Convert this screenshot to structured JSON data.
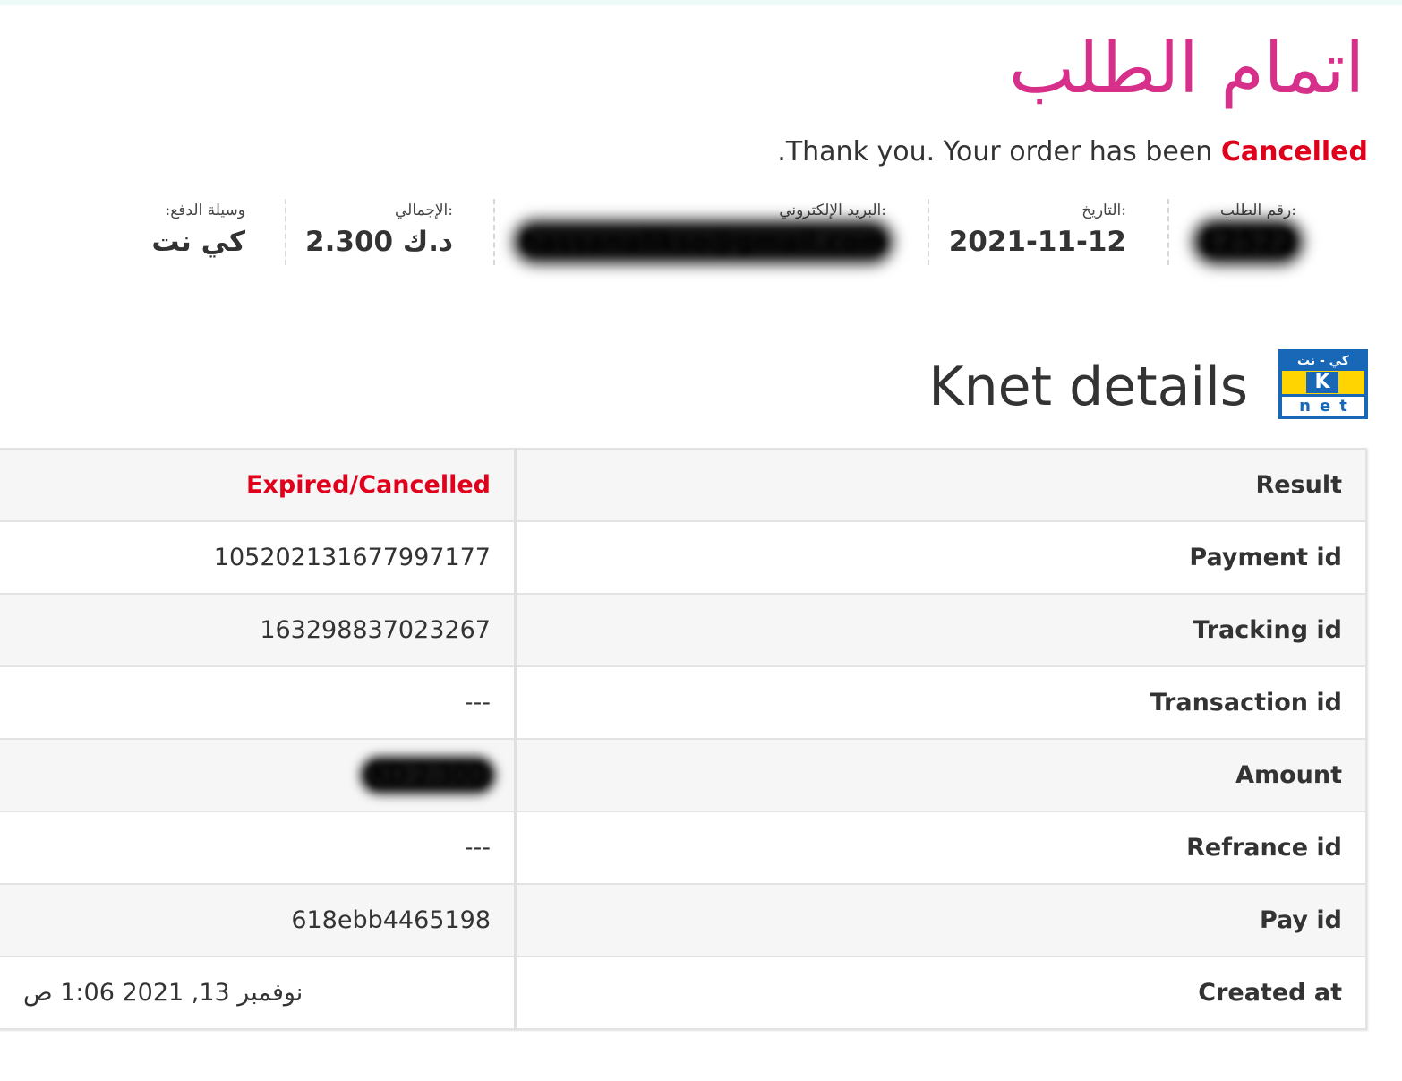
{
  "page": {
    "title": "اتمام الطلب",
    "thank_you_prefix": ".Thank you. Your order has been ",
    "order_status": "Cancelled"
  },
  "overview": {
    "order_number": {
      "label": "رقم الطلب:",
      "value": "12522"
    },
    "date": {
      "label": "التاريخ:",
      "value": "2021-11-12"
    },
    "email": {
      "label": "البريد الإلكتروني:",
      "value": "hassanalikso@gmail.com"
    },
    "total": {
      "label": "الإجمالي:",
      "value": "2.300 د.ك"
    },
    "payment_method": {
      "label": "وسيلة الدفع:",
      "value": "كي نت"
    }
  },
  "knet": {
    "heading": "Knet details",
    "logo_top_text": "كي - نت",
    "logo_letter": "K",
    "logo_bottom_text": "net",
    "brand_blue": "#1868b7",
    "brand_yellow": "#ffd400"
  },
  "details": {
    "rows": [
      {
        "key": "Result",
        "value": "Expired/Cancelled"
      },
      {
        "key": "Payment id",
        "value": "105202131677997177"
      },
      {
        "key": "Tracking id",
        "value": "163298837023267"
      },
      {
        "key": "Transaction id",
        "value": "---"
      },
      {
        "key": "Amount",
        "value": "KD 2.300"
      },
      {
        "key": "Refrance id",
        "value": "---"
      },
      {
        "key": "Pay id",
        "value": "618ebb4465198"
      },
      {
        "key": "Created at",
        "value": "نوفمبر 13, 2021 1:06 ص"
      }
    ]
  },
  "colors": {
    "title_pink": "#d6308a",
    "status_red": "#e0001b"
  }
}
